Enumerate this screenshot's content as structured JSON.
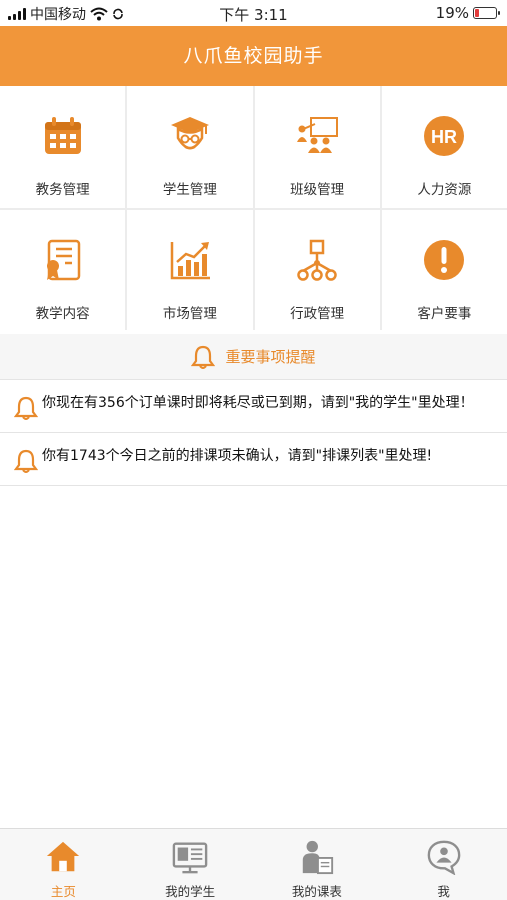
{
  "status_bar": {
    "carrier": "中国移动",
    "time": "下午 3:11",
    "battery_percent": "19%",
    "battery_level": 0.19
  },
  "header": {
    "title": "八爪鱼校园助手"
  },
  "grid_items": [
    {
      "label": "教务管理",
      "icon": "calendar-icon"
    },
    {
      "label": "学生管理",
      "icon": "graduate-icon"
    },
    {
      "label": "班级管理",
      "icon": "class-teaching-icon"
    },
    {
      "label": "人力资源",
      "icon": "hr-icon"
    },
    {
      "label": "教学内容",
      "icon": "certificate-icon"
    },
    {
      "label": "市场管理",
      "icon": "growth-chart-icon"
    },
    {
      "label": "行政管理",
      "icon": "org-chart-icon"
    },
    {
      "label": "客户要事",
      "icon": "alert-icon"
    }
  ],
  "reminder": {
    "title": "重要事项提醒",
    "items": [
      "你现在有356个订单课时即将耗尽或已到期，请到\"我的学生\"里处理！",
      "你有1743个今日之前的排课项未确认，请到\"排课列表\"里处理!"
    ]
  },
  "tabs": [
    {
      "label": "主页",
      "icon": "home-icon",
      "active": true
    },
    {
      "label": "我的学生",
      "icon": "student-board-icon",
      "active": false
    },
    {
      "label": "我的课表",
      "icon": "teacher-icon",
      "active": false
    },
    {
      "label": "我",
      "icon": "chat-person-icon",
      "active": false
    }
  ],
  "colors": {
    "accent": "#f1963a",
    "icon": "#e88a2c",
    "inactive_icon": "#8e8e8e"
  }
}
